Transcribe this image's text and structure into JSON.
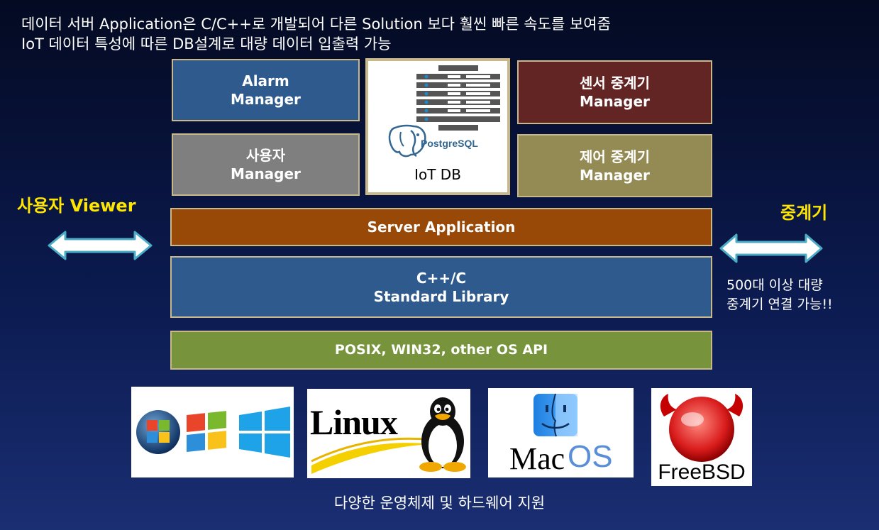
{
  "headlines": [
    "데이터 서버  Application은 C/C++로 개발되어 다른 Solution 보다 훨씬 빠른 속도를 보여줌",
    "IoT 데이터 특성에 따른 DB설계로 대량 데이터 입출력 가능"
  ],
  "modules": {
    "alarm": [
      "Alarm",
      "Manager"
    ],
    "user": [
      "사용자",
      "Manager"
    ],
    "sensor_relay": [
      "센서 중계기",
      "Manager"
    ],
    "control_relay": [
      "제어 중계기",
      "Manager"
    ]
  },
  "iot_db": {
    "label": "IoT DB",
    "logo_text": "PostgreSQL"
  },
  "layers": {
    "server_app": "Server Application",
    "stdlib": [
      "C++/C",
      "Standard Library"
    ],
    "os_api": "POSIX, WIN32, other OS API"
  },
  "left_label": "사용자 Viewer",
  "right_label": "중계기",
  "relay_note": [
    "500대 이상 대량",
    "중계기 연결 가능!!"
  ],
  "os_logos": {
    "linux": "Linux",
    "macos_mac": "Mac",
    "macos_os": "OS",
    "freebsd": "FreeBSD"
  },
  "caption": "다양한 운영체제 및 하드웨어 지원",
  "colors": {
    "alarm": "#2f5a8e",
    "user": "#7f7f7f",
    "sensor_relay": "#632523",
    "control_relay": "#948a54",
    "server_app": "#984807",
    "stdlib": "#2f5a8e",
    "os_api": "#77933c",
    "highlight": "#ffe600",
    "arrow_fill": "#ffffff",
    "arrow_stroke": "#4bacc6"
  }
}
